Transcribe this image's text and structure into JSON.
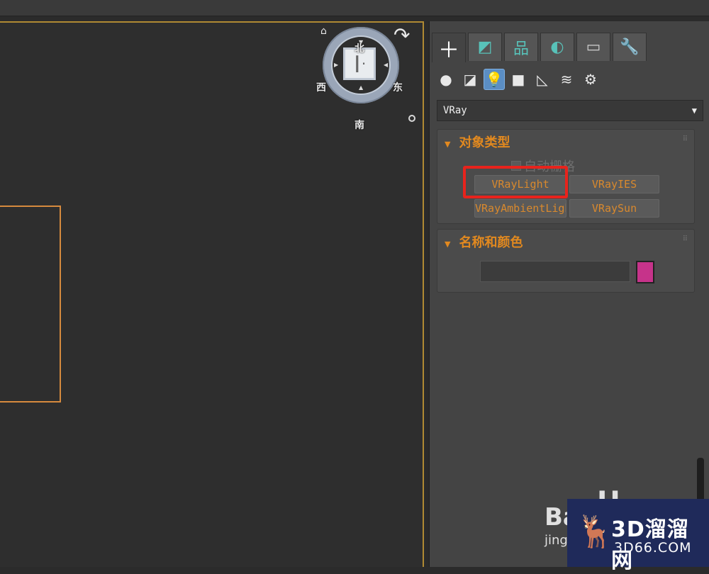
{
  "viewport": {
    "viewcube": {
      "north": "北",
      "east": "东",
      "south": "南",
      "west": "西",
      "face_glyph": "┃·"
    },
    "icons": {
      "home": "home-icon",
      "rotate": "rotate-icon",
      "menu": "viewcube-menu-icon"
    }
  },
  "command_panel": {
    "tabs": [
      {
        "name": "create",
        "glyph": "＋",
        "icon": "plus-icon"
      },
      {
        "name": "modify",
        "glyph": "◩",
        "icon": "modify-icon"
      },
      {
        "name": "hierarchy",
        "glyph": "品",
        "icon": "hierarchy-icon"
      },
      {
        "name": "motion",
        "glyph": "◐",
        "icon": "motion-icon"
      },
      {
        "name": "display",
        "glyph": "▭",
        "icon": "display-icon"
      },
      {
        "name": "utilities",
        "glyph": "🔧",
        "icon": "wrench-icon"
      }
    ],
    "subtabs": [
      {
        "name": "geometry",
        "glyph": "●"
      },
      {
        "name": "shapes",
        "glyph": "◪"
      },
      {
        "name": "lights",
        "glyph": "💡"
      },
      {
        "name": "cameras",
        "glyph": "■"
      },
      {
        "name": "helpers",
        "glyph": "◺"
      },
      {
        "name": "space-warps",
        "glyph": "≋"
      },
      {
        "name": "systems",
        "glyph": "⚙"
      }
    ],
    "category_dropdown": {
      "selected": "VRay",
      "arrow": "▼"
    },
    "object_type": {
      "title": "对象类型",
      "collapse_arrow": "▼",
      "autogrid_label": "自动栅格",
      "buttons": [
        "VRayLight",
        "VRayIES",
        "VRayAmbientLight",
        "VRaySun"
      ]
    },
    "name_and_color": {
      "title": "名称和颜色",
      "collapse_arrow": "▼",
      "name_value": "",
      "swatch_color": "#c6338a"
    }
  },
  "watermark": {
    "brand": "3D溜溜网",
    "site": "3D66.COM",
    "baidu_text": "Bai",
    "baidu_sub": "jing"
  },
  "colors": {
    "accent_orange": "#e2891f",
    "highlight_red": "#e8231c",
    "viewport_border": "#b08a33"
  }
}
